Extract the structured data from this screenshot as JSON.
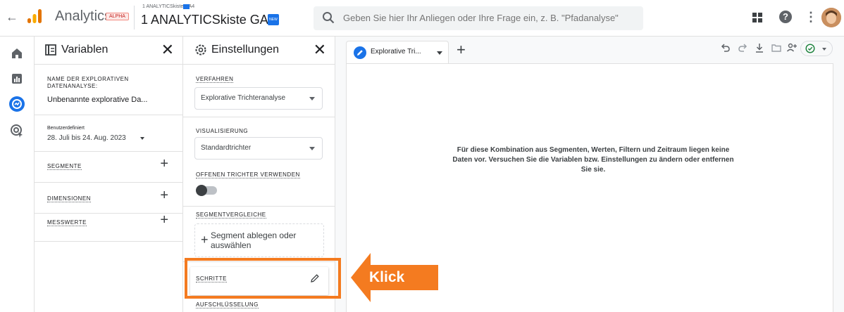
{
  "topbar": {
    "app_title": "Analytics",
    "alpha_badge": "ALPHA",
    "account_sub": "1 ANALYTICSkiste GA4",
    "account_main": "1 ANALYTICSkiste GA4",
    "new_badge": "NEW",
    "search_placeholder": "Geben Sie hier Ihr Anliegen oder Ihre Frage ein, z. B. \"Pfadanalyse\"",
    "help": "?"
  },
  "variables_panel": {
    "title": "Variablen",
    "exploration_name_label": "NAME DER EXPLORATIVEN DATENANALYSE:",
    "exploration_name_value": "Unbenannte explorative Da...",
    "date_label": "Benutzerdefiniert",
    "date_value": "28. Juli bis 24. Aug. 2023",
    "segments_label": "SEGMENTE",
    "dimensions_label": "DIMENSIONEN",
    "metrics_label": "MESSWERTE"
  },
  "settings_panel": {
    "title": "Einstellungen",
    "technique_label": "VERFAHREN",
    "technique_value": "Explorative Trichteranalyse",
    "visualization_label": "VISUALISIERUNG",
    "visualization_value": "Standardtrichter",
    "open_funnel_label": "OFFENEN TRICHTER VERWENDEN",
    "segment_comparisons_label": "SEGMENTVERGLEICHE",
    "segment_drop_text": "Segment ablegen oder auswählen",
    "steps_label": "SCHRITTE",
    "breakdown_label": "AUFSCHLÜSSELUNG"
  },
  "canvas": {
    "tab_label": "Explorative Tri...",
    "empty_message": "Für diese Kombination aus Segmenten, Werten, Filtern und Zeitraum liegen keine Daten vor. Versuchen Sie die Variablen bzw. Einstellungen zu ändern oder entfernen Sie sie."
  },
  "annotation": {
    "callout_text": "Klick",
    "accent_color": "#f47b20"
  }
}
